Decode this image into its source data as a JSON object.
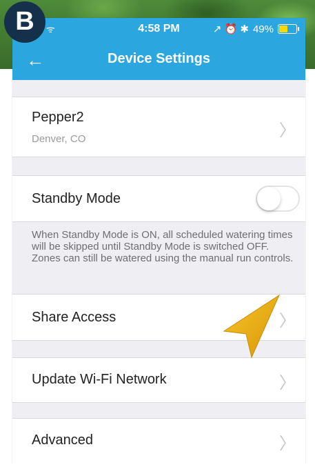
{
  "badge": "B",
  "status_bar": {
    "left": "◦ ᯤ",
    "time": "4:58 PM",
    "right_icons": "↗ ⏰ ✱",
    "battery": "49%"
  },
  "nav": {
    "back": "←",
    "title": "Device Settings"
  },
  "device": {
    "name": "Pepper2",
    "location": "Denver, CO"
  },
  "standby": {
    "label": "Standby Mode",
    "enabled": false,
    "note": "When Standby Mode is ON, all scheduled watering times will be skipped until Standby Mode is switched OFF. Zones can still be watered using the manual run controls."
  },
  "menu": {
    "share_access": "Share Access",
    "update_wifi": "Update Wi-Fi Network",
    "advanced": "Advanced"
  },
  "chevron": "〉",
  "colors": {
    "header": "#2ba6de",
    "pointer": "#f2b10f",
    "badge": "#14304a"
  }
}
